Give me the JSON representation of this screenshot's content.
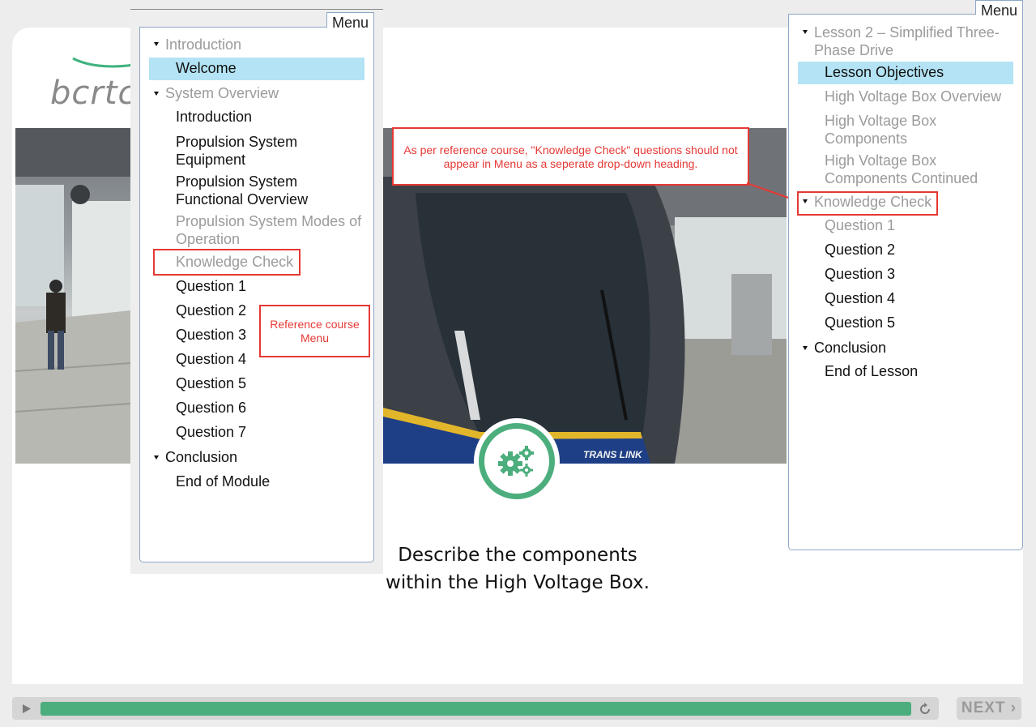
{
  "slide": {
    "logo_text": "bcrtc",
    "title_line1": "Describe the components",
    "title_line2": "within the High Voltage Box."
  },
  "photo_right": {
    "train_label": "TRANS LINK"
  },
  "icons": {
    "gear": "gear-icon",
    "play": "play-icon",
    "replay": "replay-icon",
    "next": "chevron-right-icon",
    "expand": "triangle-down-icon"
  },
  "playback": {
    "progress_fraction": 1.0,
    "next_label": "NEXT ›"
  },
  "left_menu": {
    "tab_label": "Menu",
    "introduction": {
      "label": "Introduction",
      "items": [
        "Welcome"
      ]
    },
    "system_overview": {
      "label": "System Overview",
      "items": [
        "Introduction",
        "Propulsion System Equipment",
        "Propulsion System Functional Overview",
        "Propulsion System Modes of Operation"
      ]
    },
    "knowledge_check": "Knowledge Check",
    "questions": [
      "Question 1",
      "Question 2",
      "Question 3",
      "Question 4",
      "Question 5",
      "Question 6",
      "Question 7"
    ],
    "conclusion": {
      "label": "Conclusion",
      "items": [
        "End of Module"
      ]
    }
  },
  "right_menu": {
    "tab_label": "Menu",
    "lesson": {
      "label": "Lesson 2 – Simplified Three-Phase Drive",
      "items": [
        "Lesson Objectives",
        "High Voltage Box Overview",
        "High Voltage Box Components",
        "High Voltage Box Components Continued"
      ]
    },
    "knowledge_check": {
      "label": "Knowledge Check",
      "items": [
        "Question 1",
        "Question 2",
        "Question 3",
        "Question 4",
        "Question 5"
      ]
    },
    "conclusion": {
      "label": "Conclusion",
      "items": [
        "End of Lesson"
      ]
    }
  },
  "annotations": {
    "top_note": "As per reference course, \"Knowledge Check\" questions should not appear in Menu as a seperate drop-down heading.",
    "reference_note": "Reference course Menu"
  },
  "colors": {
    "accent": "#4cae7c",
    "highlight": "#b3e3f4",
    "annotation": "#e53935"
  }
}
